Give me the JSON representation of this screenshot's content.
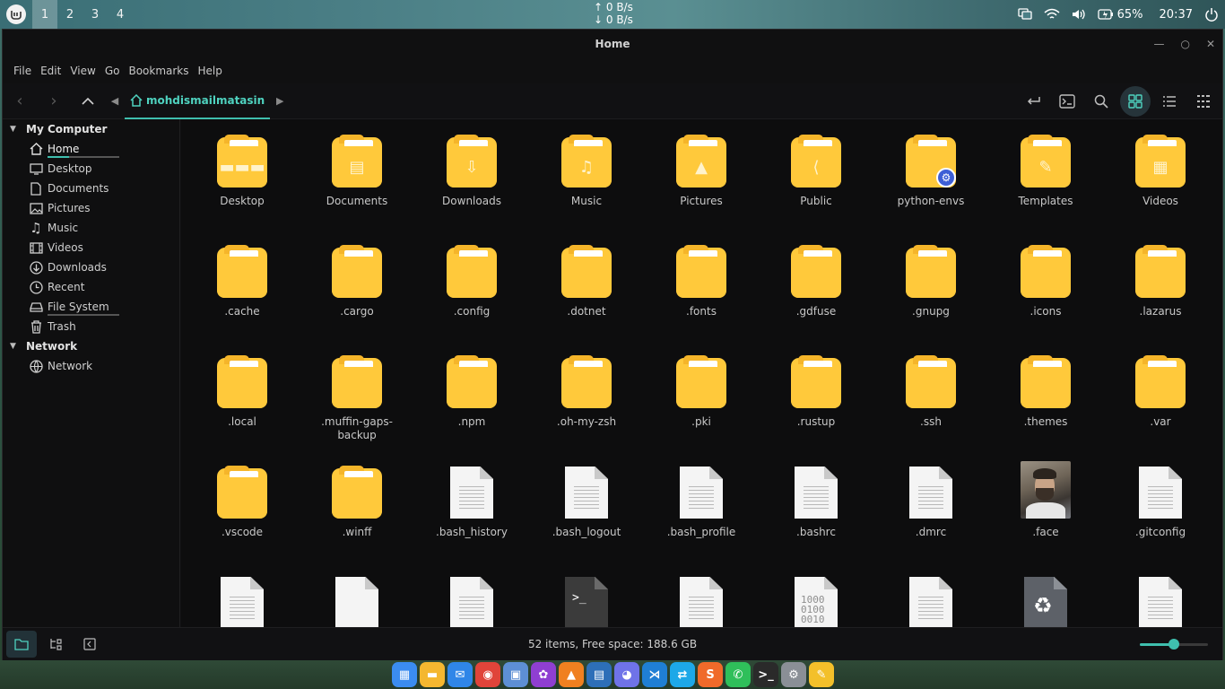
{
  "top_panel": {
    "workspaces": [
      "1",
      "2",
      "3",
      "4"
    ],
    "active_workspace": "1",
    "net_up": "↑ 0 B/s",
    "net_down": "↓ 0 B/s",
    "battery": "65%",
    "clock": "20:37"
  },
  "window": {
    "title": "Home",
    "menu": [
      "File",
      "Edit",
      "View",
      "Go",
      "Bookmarks",
      "Help"
    ],
    "breadcrumb": "mohdismailmatasin"
  },
  "sidebar": {
    "sections": [
      {
        "title": "My Computer",
        "items": [
          {
            "label": "Home",
            "icon": "home-icon"
          },
          {
            "label": "Desktop",
            "icon": "desktop-icon"
          },
          {
            "label": "Documents",
            "icon": "documents-icon"
          },
          {
            "label": "Pictures",
            "icon": "pictures-icon"
          },
          {
            "label": "Music",
            "icon": "music-icon"
          },
          {
            "label": "Videos",
            "icon": "videos-icon"
          },
          {
            "label": "Downloads",
            "icon": "downloads-icon"
          },
          {
            "label": "Recent",
            "icon": "recent-icon"
          },
          {
            "label": "File System",
            "icon": "drive-icon"
          },
          {
            "label": "Trash",
            "icon": "trash-icon"
          }
        ]
      },
      {
        "title": "Network",
        "items": [
          {
            "label": "Network",
            "icon": "network-icon"
          }
        ]
      }
    ]
  },
  "files": [
    {
      "name": "Desktop",
      "kind": "folder",
      "glyph": "▬▬▬"
    },
    {
      "name": "Documents",
      "kind": "folder",
      "glyph": "▤"
    },
    {
      "name": "Downloads",
      "kind": "folder",
      "glyph": "⇩"
    },
    {
      "name": "Music",
      "kind": "folder",
      "glyph": "♫"
    },
    {
      "name": "Pictures",
      "kind": "folder",
      "glyph": "▲"
    },
    {
      "name": "Public",
      "kind": "folder",
      "glyph": "⟨"
    },
    {
      "name": "python-envs",
      "kind": "folder",
      "glyph": "",
      "badge": "⚙"
    },
    {
      "name": "Templates",
      "kind": "folder",
      "glyph": "✎"
    },
    {
      "name": "Videos",
      "kind": "folder",
      "glyph": "▦"
    },
    {
      "name": ".cache",
      "kind": "folder"
    },
    {
      "name": ".cargo",
      "kind": "folder"
    },
    {
      "name": ".config",
      "kind": "folder"
    },
    {
      "name": ".dotnet",
      "kind": "folder"
    },
    {
      "name": ".fonts",
      "kind": "folder"
    },
    {
      "name": ".gdfuse",
      "kind": "folder"
    },
    {
      "name": ".gnupg",
      "kind": "folder"
    },
    {
      "name": ".icons",
      "kind": "folder"
    },
    {
      "name": ".lazarus",
      "kind": "folder"
    },
    {
      "name": ".local",
      "kind": "folder"
    },
    {
      "name": ".muffin-gaps-backup",
      "kind": "folder"
    },
    {
      "name": ".npm",
      "kind": "folder"
    },
    {
      "name": ".oh-my-zsh",
      "kind": "folder"
    },
    {
      "name": ".pki",
      "kind": "folder"
    },
    {
      "name": ".rustup",
      "kind": "folder"
    },
    {
      "name": ".ssh",
      "kind": "folder"
    },
    {
      "name": ".themes",
      "kind": "folder"
    },
    {
      "name": ".var",
      "kind": "folder"
    },
    {
      "name": ".vscode",
      "kind": "folder"
    },
    {
      "name": ".winff",
      "kind": "folder"
    },
    {
      "name": ".bash_history",
      "kind": "text"
    },
    {
      "name": ".bash_logout",
      "kind": "text"
    },
    {
      "name": ".bash_profile",
      "kind": "text"
    },
    {
      "name": ".bashrc",
      "kind": "text"
    },
    {
      "name": ".dmrc",
      "kind": "text"
    },
    {
      "name": ".face",
      "kind": "image"
    },
    {
      "name": ".gitconfig",
      "kind": "text"
    },
    {
      "name": "",
      "kind": "text"
    },
    {
      "name": "",
      "kind": "plain"
    },
    {
      "name": "",
      "kind": "text"
    },
    {
      "name": "",
      "kind": "terminal",
      "glyph": ">_"
    },
    {
      "name": "",
      "kind": "text"
    },
    {
      "name": "",
      "kind": "binary",
      "glyph": "1000\n0100\n0010"
    },
    {
      "name": "",
      "kind": "text"
    },
    {
      "name": "",
      "kind": "recycle",
      "glyph": "♻"
    },
    {
      "name": "",
      "kind": "text"
    }
  ],
  "statusbar": {
    "text": "52 items, Free space: 188.6 GB",
    "zoom_level": 0.5
  },
  "dock": {
    "apps": [
      {
        "name": "app-grid",
        "color": "#3b8cf0",
        "glyph": "▦"
      },
      {
        "name": "files",
        "color": "#f4b730",
        "glyph": "▬"
      },
      {
        "name": "mail",
        "color": "#2f86e8",
        "glyph": "✉"
      },
      {
        "name": "chrome",
        "color": "#e0443a",
        "glyph": "◉"
      },
      {
        "name": "image-viewer",
        "color": "#5d8fd4",
        "glyph": "▣"
      },
      {
        "name": "paint",
        "color": "#8f3fd1",
        "glyph": "✿"
      },
      {
        "name": "vlc",
        "color": "#f08020",
        "glyph": "▲"
      },
      {
        "name": "office",
        "color": "#2d6fb8",
        "glyph": "▤"
      },
      {
        "name": "discord",
        "color": "#6f73e8",
        "glyph": "◕"
      },
      {
        "name": "vscode",
        "color": "#1f7fd4",
        "glyph": "⋊"
      },
      {
        "name": "remote",
        "color": "#1da8e8",
        "glyph": "⇄"
      },
      {
        "name": "sublime-like",
        "color": "#f06a2a",
        "glyph": "S"
      },
      {
        "name": "whatsapp",
        "color": "#2fbf5a",
        "glyph": "✆"
      },
      {
        "name": "terminal",
        "color": "#2a2a2a",
        "glyph": ">_"
      },
      {
        "name": "settings",
        "color": "#8a8f96",
        "glyph": "⚙"
      },
      {
        "name": "notes",
        "color": "#f3c02a",
        "glyph": "✎"
      }
    ]
  },
  "colors": {
    "accent": "#3fbfae",
    "folder": "#ffc93b",
    "window_bg": "#0f0f10"
  }
}
